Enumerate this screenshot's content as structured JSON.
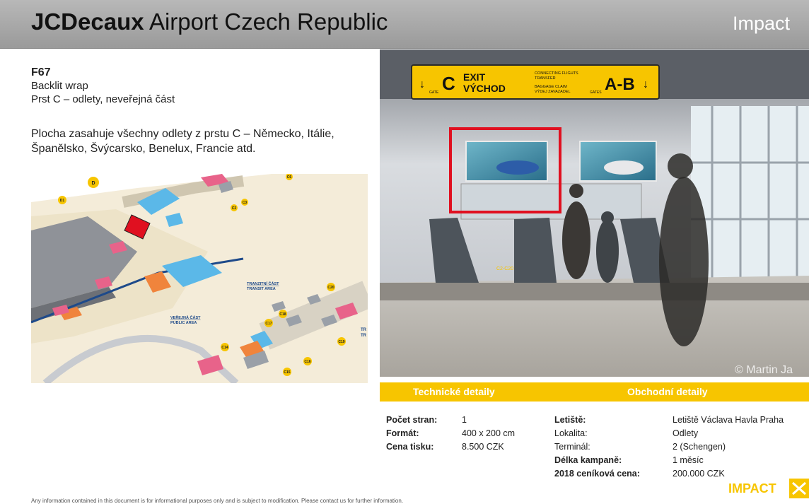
{
  "header": {
    "brand_bold": "JCDecaux",
    "brand_rest": " Airport Czech Republic",
    "section": "Impact"
  },
  "item": {
    "code": "F67",
    "format": "Backlit wrap",
    "location": "Prst C –  odlety, neveřejná část",
    "description": "Plocha zasahuje všechny odlety z prstu C – Německo, Itálie, Španělsko, Švýcarsko, Benelux, Francie atd."
  },
  "map": {
    "labels": [
      "D",
      "D1",
      "C6",
      "C2",
      "C3",
      "C20",
      "C18",
      "C17",
      "C19",
      "C14",
      "C16",
      "C15",
      "TR",
      "TR"
    ],
    "area_transit": [
      "TRANZITNÍ ČÁST",
      "TRANSIT AREA"
    ],
    "area_public": [
      "VEŘEJNÁ ČÁST",
      "PUBLIC AREA"
    ]
  },
  "photo": {
    "sign_left_letter": "C",
    "sign_gate": "GATE",
    "sign_exit_en": "EXIT",
    "sign_exit_cz": "VÝCHOD",
    "sign_connect_1": "CONNECTING FLIGHTS",
    "sign_connect_2": "TRANSFER",
    "sign_baggage_1": "BAGGAGE CLAIM",
    "sign_baggage_2": "VÝDEJ ZAVAZADEL",
    "sign_gates": "GATES",
    "sign_right_letters": "A-B",
    "escalator_label": "C2-C20",
    "credit": "© Martin Ja"
  },
  "tech": {
    "title": "Technické detaily",
    "rows": [
      {
        "label": "Počet stran:",
        "value": "1"
      },
      {
        "label": "Formát:",
        "value": "400 x 200 cm"
      },
      {
        "label": "Cena tisku:",
        "value": "8.500 CZK"
      }
    ]
  },
  "business": {
    "title": "Obchodní detaily",
    "rows": [
      {
        "label": "Letiště:",
        "value": "Letiště Václava Havla Praha",
        "bold": true
      },
      {
        "label": "Lokalita:",
        "value": "Odlety",
        "bold": false
      },
      {
        "label": "Terminál:",
        "value": "2 (Schengen)",
        "bold": false
      },
      {
        "label": "Délka kampaně:",
        "value": "1 měsíc",
        "bold": true
      },
      {
        "label": "2018 ceníková cena:",
        "value": "200.000 CZK",
        "bold": true
      }
    ]
  },
  "footer": {
    "disclaimer": "Any information contained in this document is for informational purposes only and is subject to modification. Please contact us for further information.",
    "logo": "IMPACT"
  },
  "colors": {
    "accent": "#f7c500",
    "header_bg": "#a8a8a8",
    "highlight": "#e01020"
  }
}
